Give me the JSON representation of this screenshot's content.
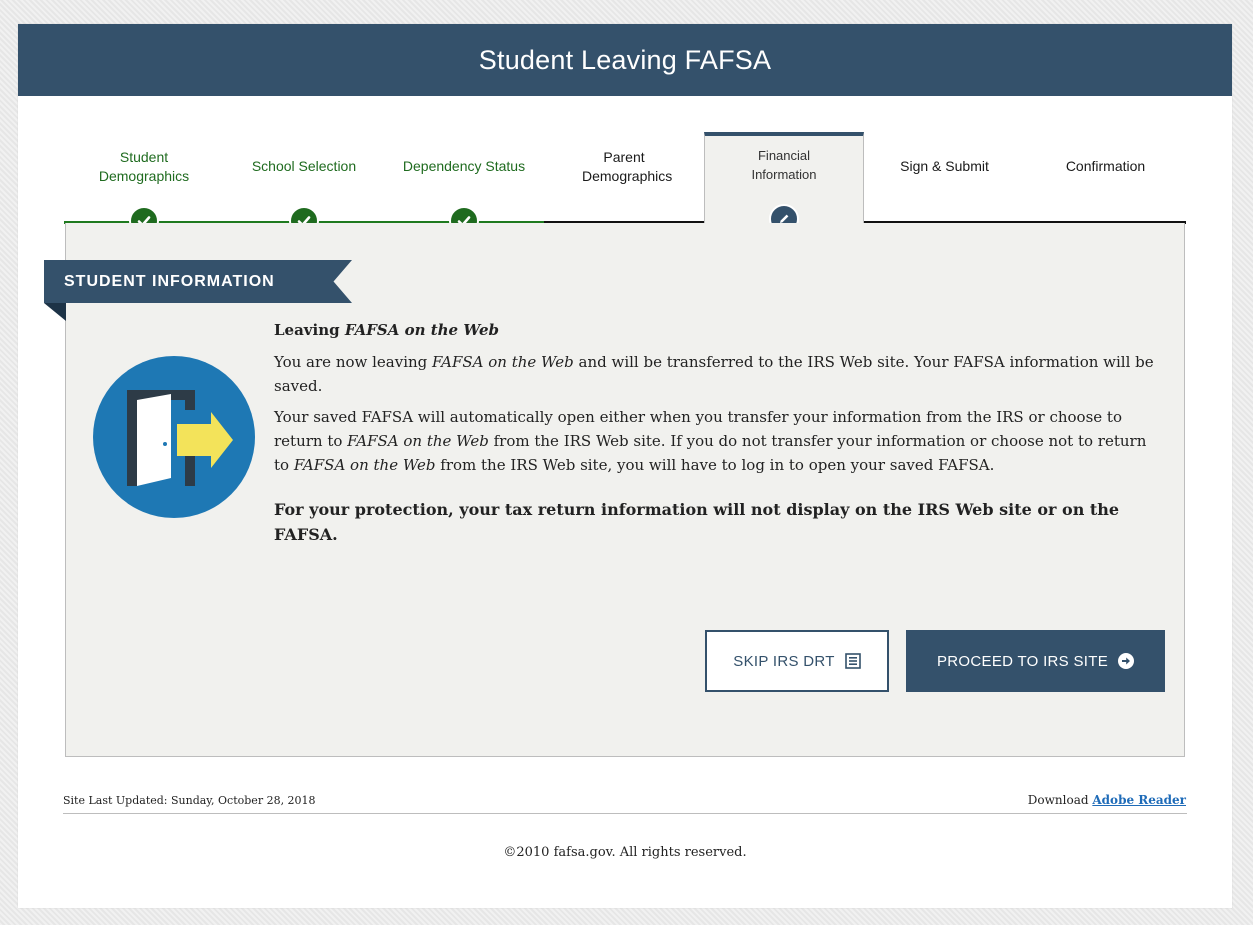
{
  "header": {
    "title": "Student Leaving FAFSA"
  },
  "steps": [
    {
      "label": "Student Demographics",
      "status": "complete"
    },
    {
      "label": "School Selection",
      "status": "complete"
    },
    {
      "label": "Dependency Status",
      "status": "complete"
    },
    {
      "label": "Parent Demographics",
      "status": "pending"
    },
    {
      "label": "Financial Information",
      "status": "active"
    },
    {
      "label": "Sign & Submit",
      "status": "pending"
    },
    {
      "label": "Confirmation",
      "status": "pending"
    }
  ],
  "section": {
    "title": "STUDENT INFORMATION"
  },
  "content": {
    "heading_prefix": "Leaving ",
    "heading_italic": "FAFSA on the Web",
    "p1_a": "You are now leaving ",
    "p1_i": "FAFSA on the Web",
    "p1_b": " and will be transferred to the IRS Web site. Your FAFSA information will be saved.",
    "p2_a": "Your saved FAFSA will automatically open either when you transfer your information from the IRS or choose to return to ",
    "p2_i1": "FAFSA on the Web",
    "p2_b": " from the IRS Web site. If you do not transfer your information or choose not to return to ",
    "p2_i2": "FAFSA on the Web",
    "p2_c": " from the IRS Web site, you will have to log in to open your saved FAFSA.",
    "notice": "For your protection, your tax return information will not display on the IRS Web site or on the FAFSA."
  },
  "buttons": {
    "skip_label": "SKIP IRS DRT",
    "proceed_label": "PROCEED TO IRS SITE"
  },
  "footer": {
    "last_updated": "Site Last Updated: Sunday, October 28, 2018",
    "download_prefix": "Download ",
    "download_link": "Adobe Reader",
    "copyright": "©2010 fafsa.gov. All rights reserved."
  },
  "colors": {
    "primary": "#34516b",
    "success": "#1f6b1f",
    "panel": "#f1f1ee",
    "icon_circle": "#1e78b4",
    "arrow": "#f3e35a"
  }
}
